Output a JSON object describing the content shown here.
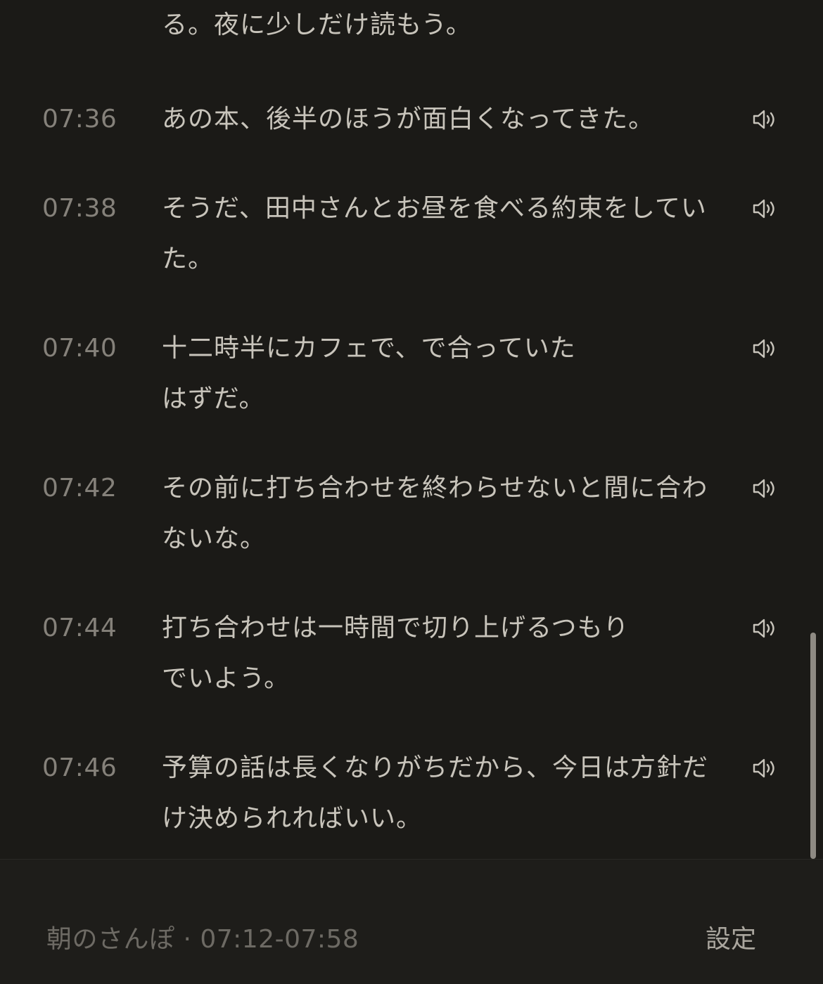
{
  "transcript": {
    "partial_top_text": "る。夜に少しだけ読もう。",
    "entries": [
      {
        "time": "07:36",
        "text": "あの本、後半のほうが面白くなってきた。"
      },
      {
        "time": "07:38",
        "text": "そうだ、田中さんとお昼を食べる約束をしていた。"
      },
      {
        "time": "07:40",
        "text": "十二時半にカフェで、で合っていた",
        "text2": "はずだ。"
      },
      {
        "time": "07:42",
        "text": "その前に打ち合わせを終わらせないと間に合わないな。"
      },
      {
        "time": "07:44",
        "text": "打ち合わせは一時間で切り上げるつもり",
        "text2": "でいよう。"
      },
      {
        "time": "07:46",
        "text": "予算の話は長くなりがちだから、今日は方針だけ決められればいい。"
      }
    ],
    "speaker_icon": "speaker-icon"
  },
  "footer": {
    "session_label": "朝のさんぽ · 07:12-07:58",
    "settings_label": "設定"
  },
  "colors": {
    "background": "#1b1a17",
    "text": "#c8c4bb",
    "time": "#85817a",
    "footer_text": "#6d6a64",
    "settings_text": "#aaa69e"
  }
}
